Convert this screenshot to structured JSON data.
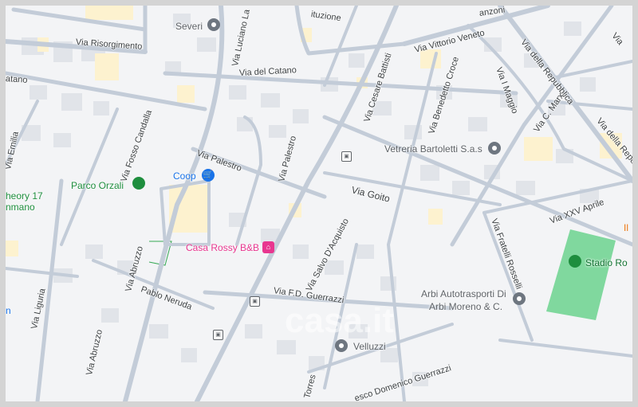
{
  "colors": {
    "background": "#f3f4f6",
    "road": "#c3ccd8",
    "road_casing": "#aab6c6",
    "building": "#e1e4e9",
    "yellow_block": "#fdf2cf",
    "park": "#80d89e",
    "poi_green": "#1e8e3e",
    "poi_blue": "#1a73e8",
    "poi_pink": "#e8368f",
    "poi_grey": "#6e7680"
  },
  "streets": [
    "Via Risorgimento",
    "Via Luciano La",
    "Via del Catano",
    "Via Palestro",
    "Via Cesare Battisti",
    "Via Vittorio Veneto",
    "Via Benedetto Croce",
    "Via della Repubblica",
    "Via della Repubbl",
    "Via C. Marx",
    "Via I Maggio",
    "Via Goito",
    "Via XXV Aprile",
    "Via Fratelli Rosselli",
    "Via Salvo D'Acquisto",
    "Via F.D. Guerrazzi",
    "Via Abruzzo",
    "Via Fosso Candalla",
    "Via Emilia",
    "Via Liguria",
    "Pablo Neruda",
    "Torres",
    "esco Domenico Guerrazzi",
    "ituzione",
    "anzoni",
    "atano",
    "Via"
  ],
  "places": {
    "parco": "Parco Orzali",
    "coop": "Coop",
    "casa": "Casa Rossy B&B",
    "vetreria": "Vetreria Bartoletti S.a.s",
    "stadio": "Stadio Ro",
    "arbi_1": "Arbi Autotrasporti Di",
    "arbi_2": "Arbi Moreno & C.",
    "velluzzi": "Velluzzi",
    "severi": "Severi",
    "theory_1": "heory 17",
    "theory_2": "nmano",
    "edge_n": "n",
    "edge_il": "Il"
  },
  "watermark": "casa.it"
}
